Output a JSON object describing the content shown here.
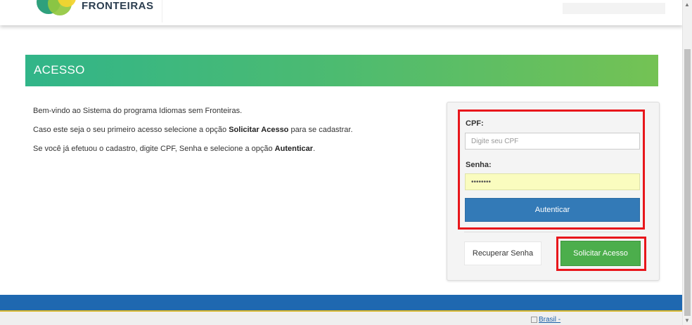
{
  "header": {
    "brand_text": "FRONTEIRAS",
    "logo_colors": [
      "#2fa07c",
      "#93c83f",
      "#f2d430"
    ]
  },
  "banner": {
    "title": "ACESSO",
    "colors": {
      "start": "#31b589",
      "end": "#74c254"
    }
  },
  "intro": {
    "line1": "Bem-vindo ao Sistema do programa Idiomas sem Fronteiras.",
    "line2_pre": "Caso este seja o seu primeiro acesso selecione a opção ",
    "line2_bold": "Solicitar Acesso",
    "line2_post": " para se cadastrar.",
    "line3_pre": "Se você já efetuou o cadastro, digite CPF, Senha e selecione a opção ",
    "line3_bold": "Autenticar",
    "line3_post": "."
  },
  "login": {
    "cpf_label": "CPF:",
    "cpf_placeholder": "Digite seu CPF",
    "password_label": "Senha:",
    "password_value": "••••••••",
    "auth_button": "Autenticar",
    "recover_button": "Recuperar Senha",
    "request_button": "Solicitar Acesso"
  },
  "footer": {
    "brasil_link": "Brasil -"
  },
  "colors": {
    "highlight": "#e8161b",
    "auth_button": "#337ab7",
    "request_button": "#4cae4c",
    "footer_bar": "#1f68b0"
  }
}
